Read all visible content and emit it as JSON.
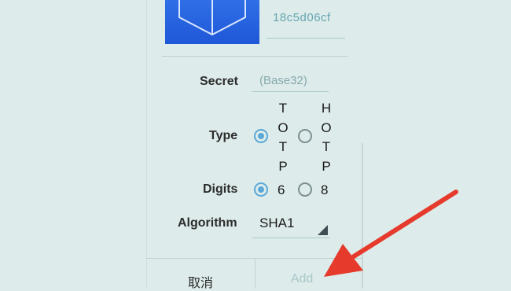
{
  "token": {
    "id_value": "18c5d06cf",
    "image_icon": "cube-icon"
  },
  "form": {
    "secret_label": "Secret",
    "secret_placeholder": "(Base32)",
    "type_label": "Type",
    "type_options": [
      {
        "letters": [
          "T",
          "O",
          "T",
          "P"
        ],
        "checked": true
      },
      {
        "letters": [
          "H",
          "O",
          "T",
          "P"
        ],
        "checked": false
      }
    ],
    "digits_label": "Digits",
    "digits_options": [
      {
        "label": "6",
        "checked": true
      },
      {
        "label": "8",
        "checked": false
      }
    ],
    "algorithm_label": "Algorithm",
    "algorithm_value": "SHA1"
  },
  "buttons": {
    "cancel": "取消",
    "add": "Add"
  },
  "annotation": {
    "arrow_color": "#e53a2c",
    "arrow_icon": "red-arrow-icon"
  },
  "colors": {
    "accent": "#5aa8d8",
    "background": "#ddecea",
    "token_blue": "#2563e0"
  }
}
